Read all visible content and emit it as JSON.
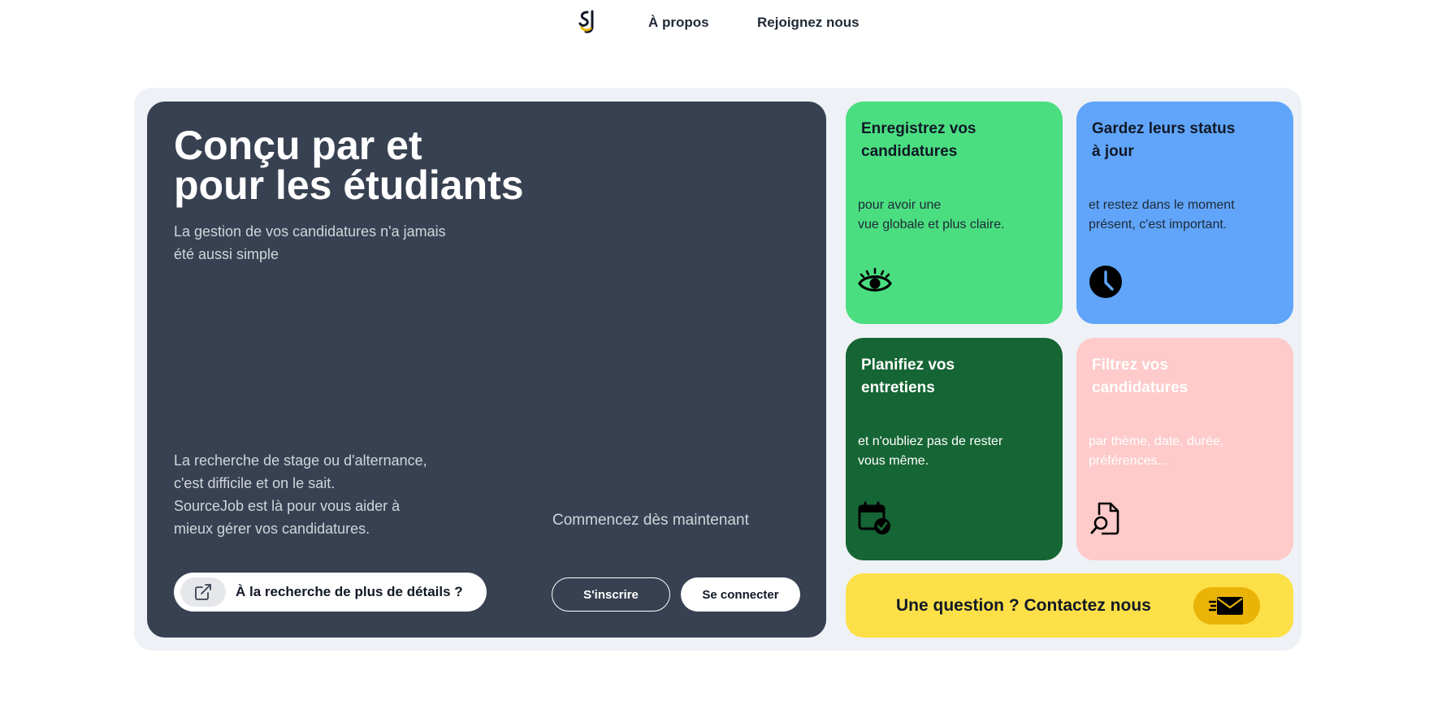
{
  "nav": {
    "logo_icon": "sourcejob-logo-icon",
    "about_label": "À propos",
    "join_label": "Rejoignez nous"
  },
  "hero": {
    "title_line1": "Conçu par et",
    "title_line2": "pour les étudiants",
    "subtitle_line1": "La gestion de vos candidatures n'a jamais",
    "subtitle_line2": "été aussi simple",
    "description_line1": "La recherche de stage ou d'alternance,",
    "description_line2": "c'est difficile et on le sait.",
    "description_line3": "SourceJob est là pour vous aider à",
    "description_line4": "mieux gérer vos candidatures.",
    "start_text": "Commencez dès maintenant",
    "details_button": "À la recherche de plus de détails ?",
    "details_icon": "external-link-icon",
    "signup_button": "S'inscrire",
    "login_button": "Se connecter",
    "background_color": "#374151"
  },
  "cards": [
    {
      "title_line1": "Enregistrez vos",
      "title_line2": "candidatures",
      "text_line1": "pour avoir une",
      "text_line2": "vue globale et plus claire.",
      "icon": "eye-icon",
      "color": "#4ade80"
    },
    {
      "title_line1": "Gardez leurs status",
      "title_line2": "à jour",
      "text_line1": "et restez dans le moment",
      "text_line2": "présent, c'est important.",
      "icon": "clock-icon",
      "color": "#60a5fa"
    },
    {
      "title_line1": "Planifiez vos",
      "title_line2": "entretiens",
      "text_line1": "et n'oubliez pas de rester",
      "text_line2": "vous même.",
      "icon": "calendar-check-icon",
      "color": "#166534"
    },
    {
      "title_line1": "Filtrez vos",
      "title_line2": "candidatures",
      "text_line1": "par thème, date, durée,",
      "text_line2": "préférences...",
      "icon": "file-search-icon",
      "color": "#fecaca"
    }
  ],
  "contact": {
    "label": "Une question ? Contactez nous",
    "icon": "mail-icon",
    "color": "#fde047"
  }
}
